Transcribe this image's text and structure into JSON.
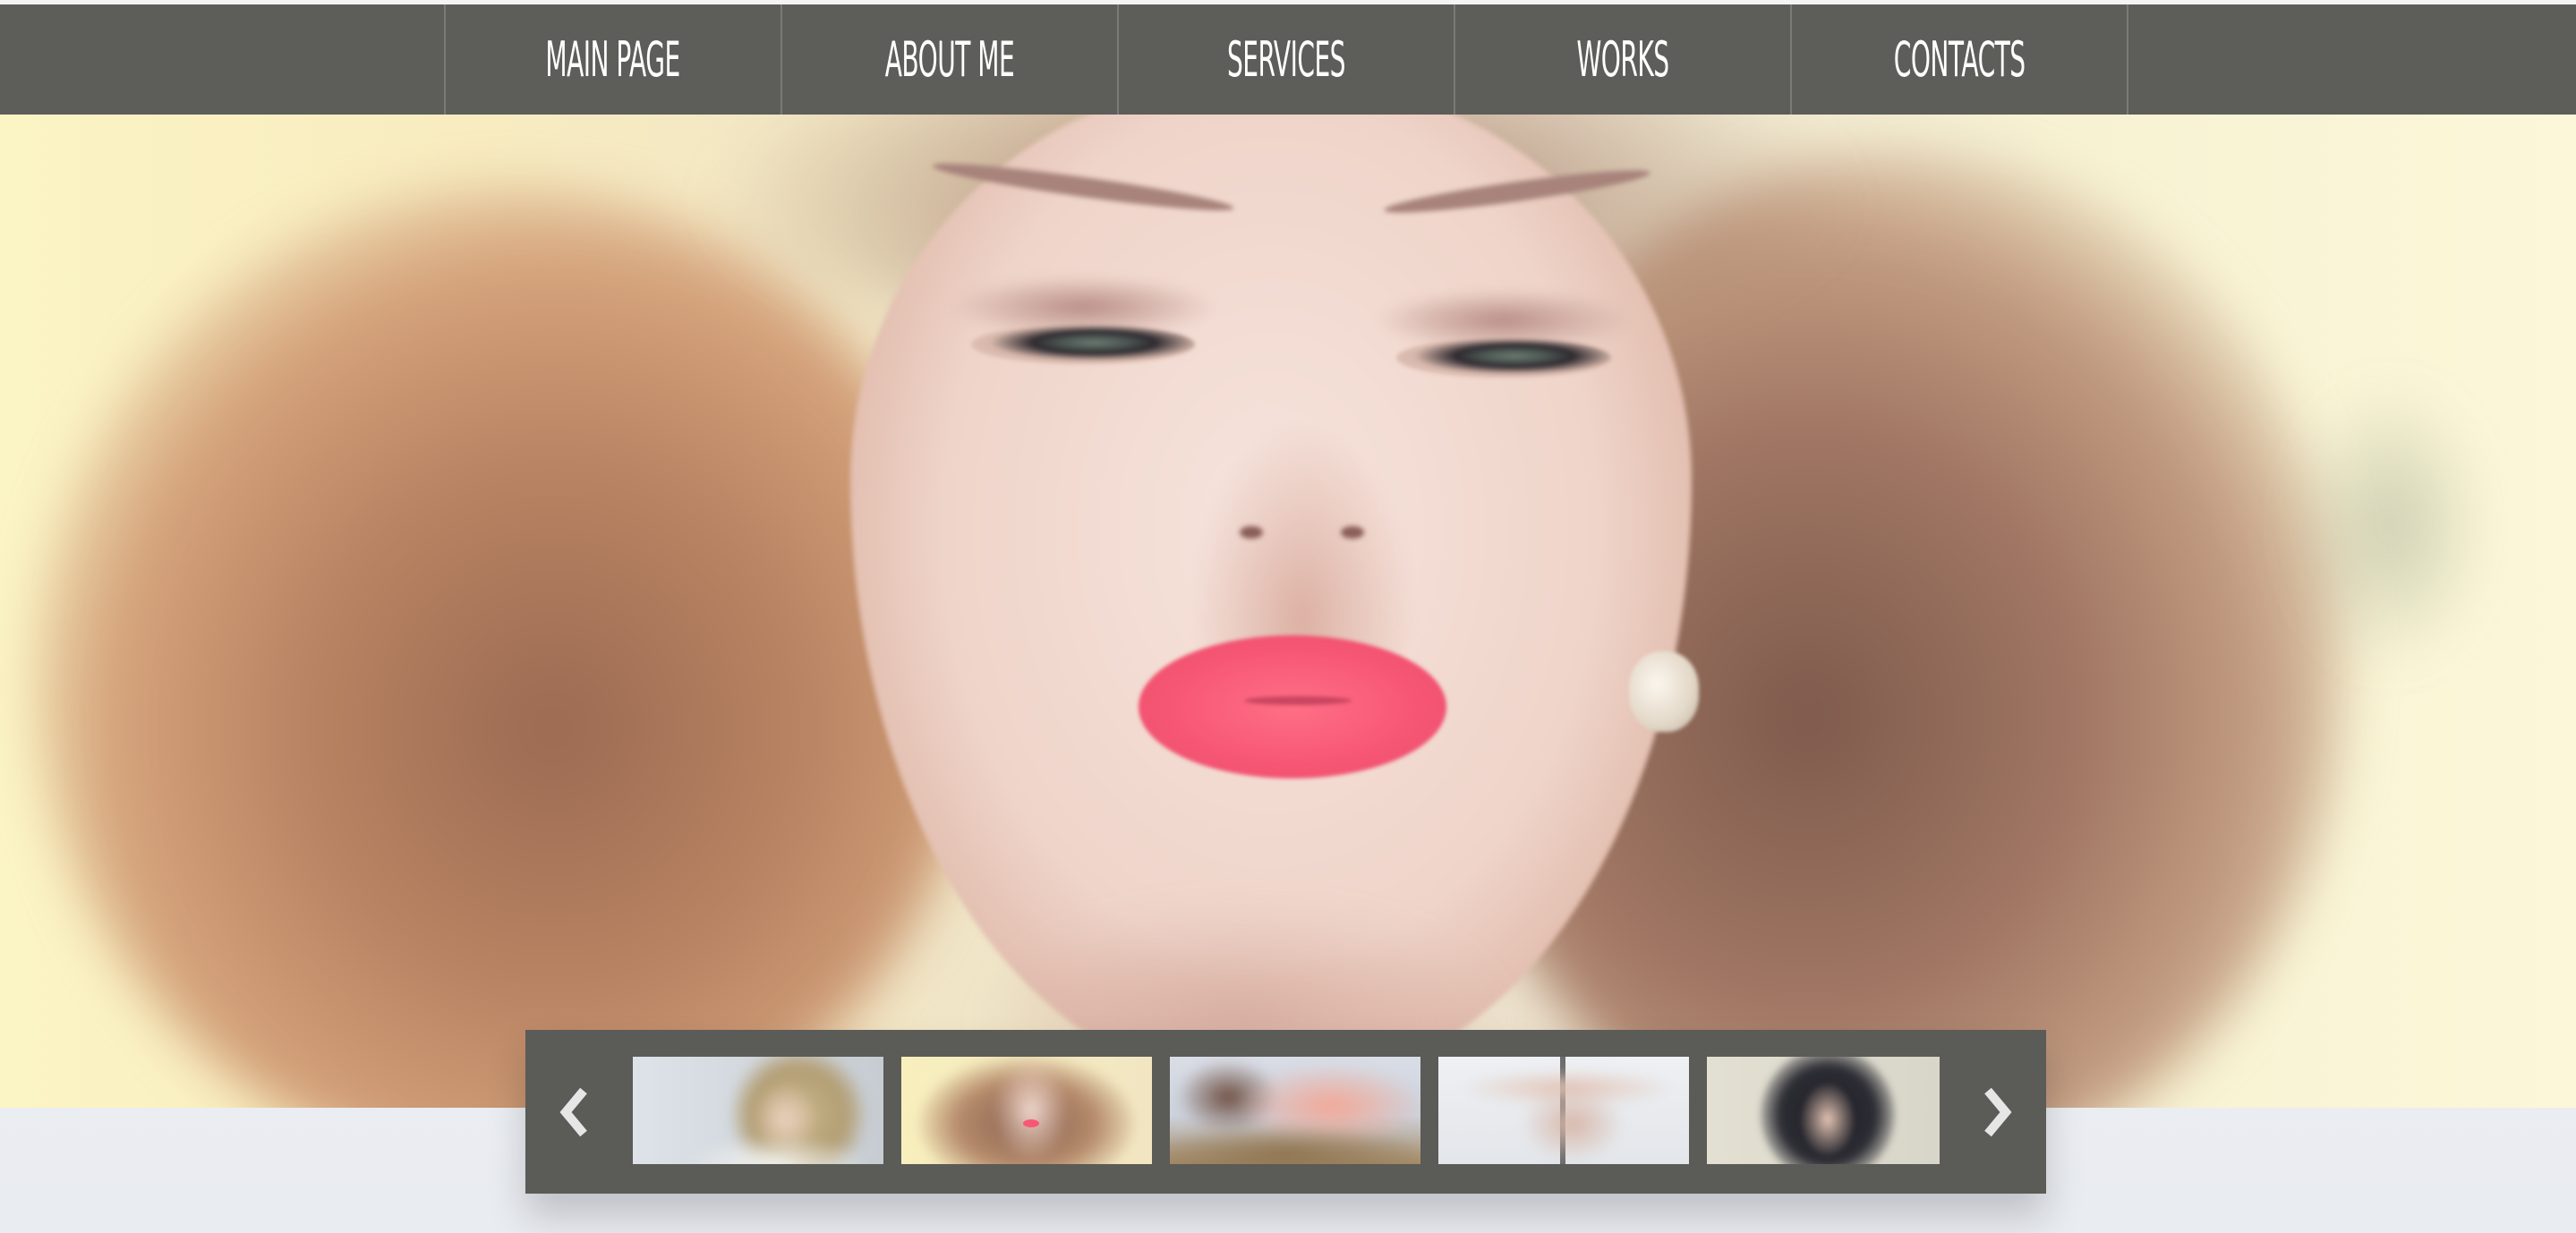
{
  "nav": {
    "items": [
      {
        "label": "MAIN PAGE"
      },
      {
        "label": "ABOUT ME"
      },
      {
        "label": "SERVICES"
      },
      {
        "label": "WORKS"
      },
      {
        "label": "CONTACTS"
      }
    ]
  },
  "hero": {
    "image": "portrait-woman-curly-hair",
    "colors": {
      "background": "#fbf4c4",
      "lips": "#f75775",
      "hair": "#a97656"
    }
  },
  "gallery": {
    "prev_icon": "chevron-left-icon",
    "next_icon": "chevron-right-icon",
    "thumbnails": [
      {
        "image": "blonde-woman-portrait"
      },
      {
        "image": "curly-hair-woman-portrait"
      },
      {
        "image": "woman-lying-on-hay"
      },
      {
        "image": "pole-dancer"
      },
      {
        "image": "dark-bob-hair-woman"
      }
    ]
  },
  "colors": {
    "nav_background": "#5d5d59",
    "nav_text": "#ffffff",
    "strip_background": "#5b5b57",
    "page_background": "#eef0f4"
  }
}
